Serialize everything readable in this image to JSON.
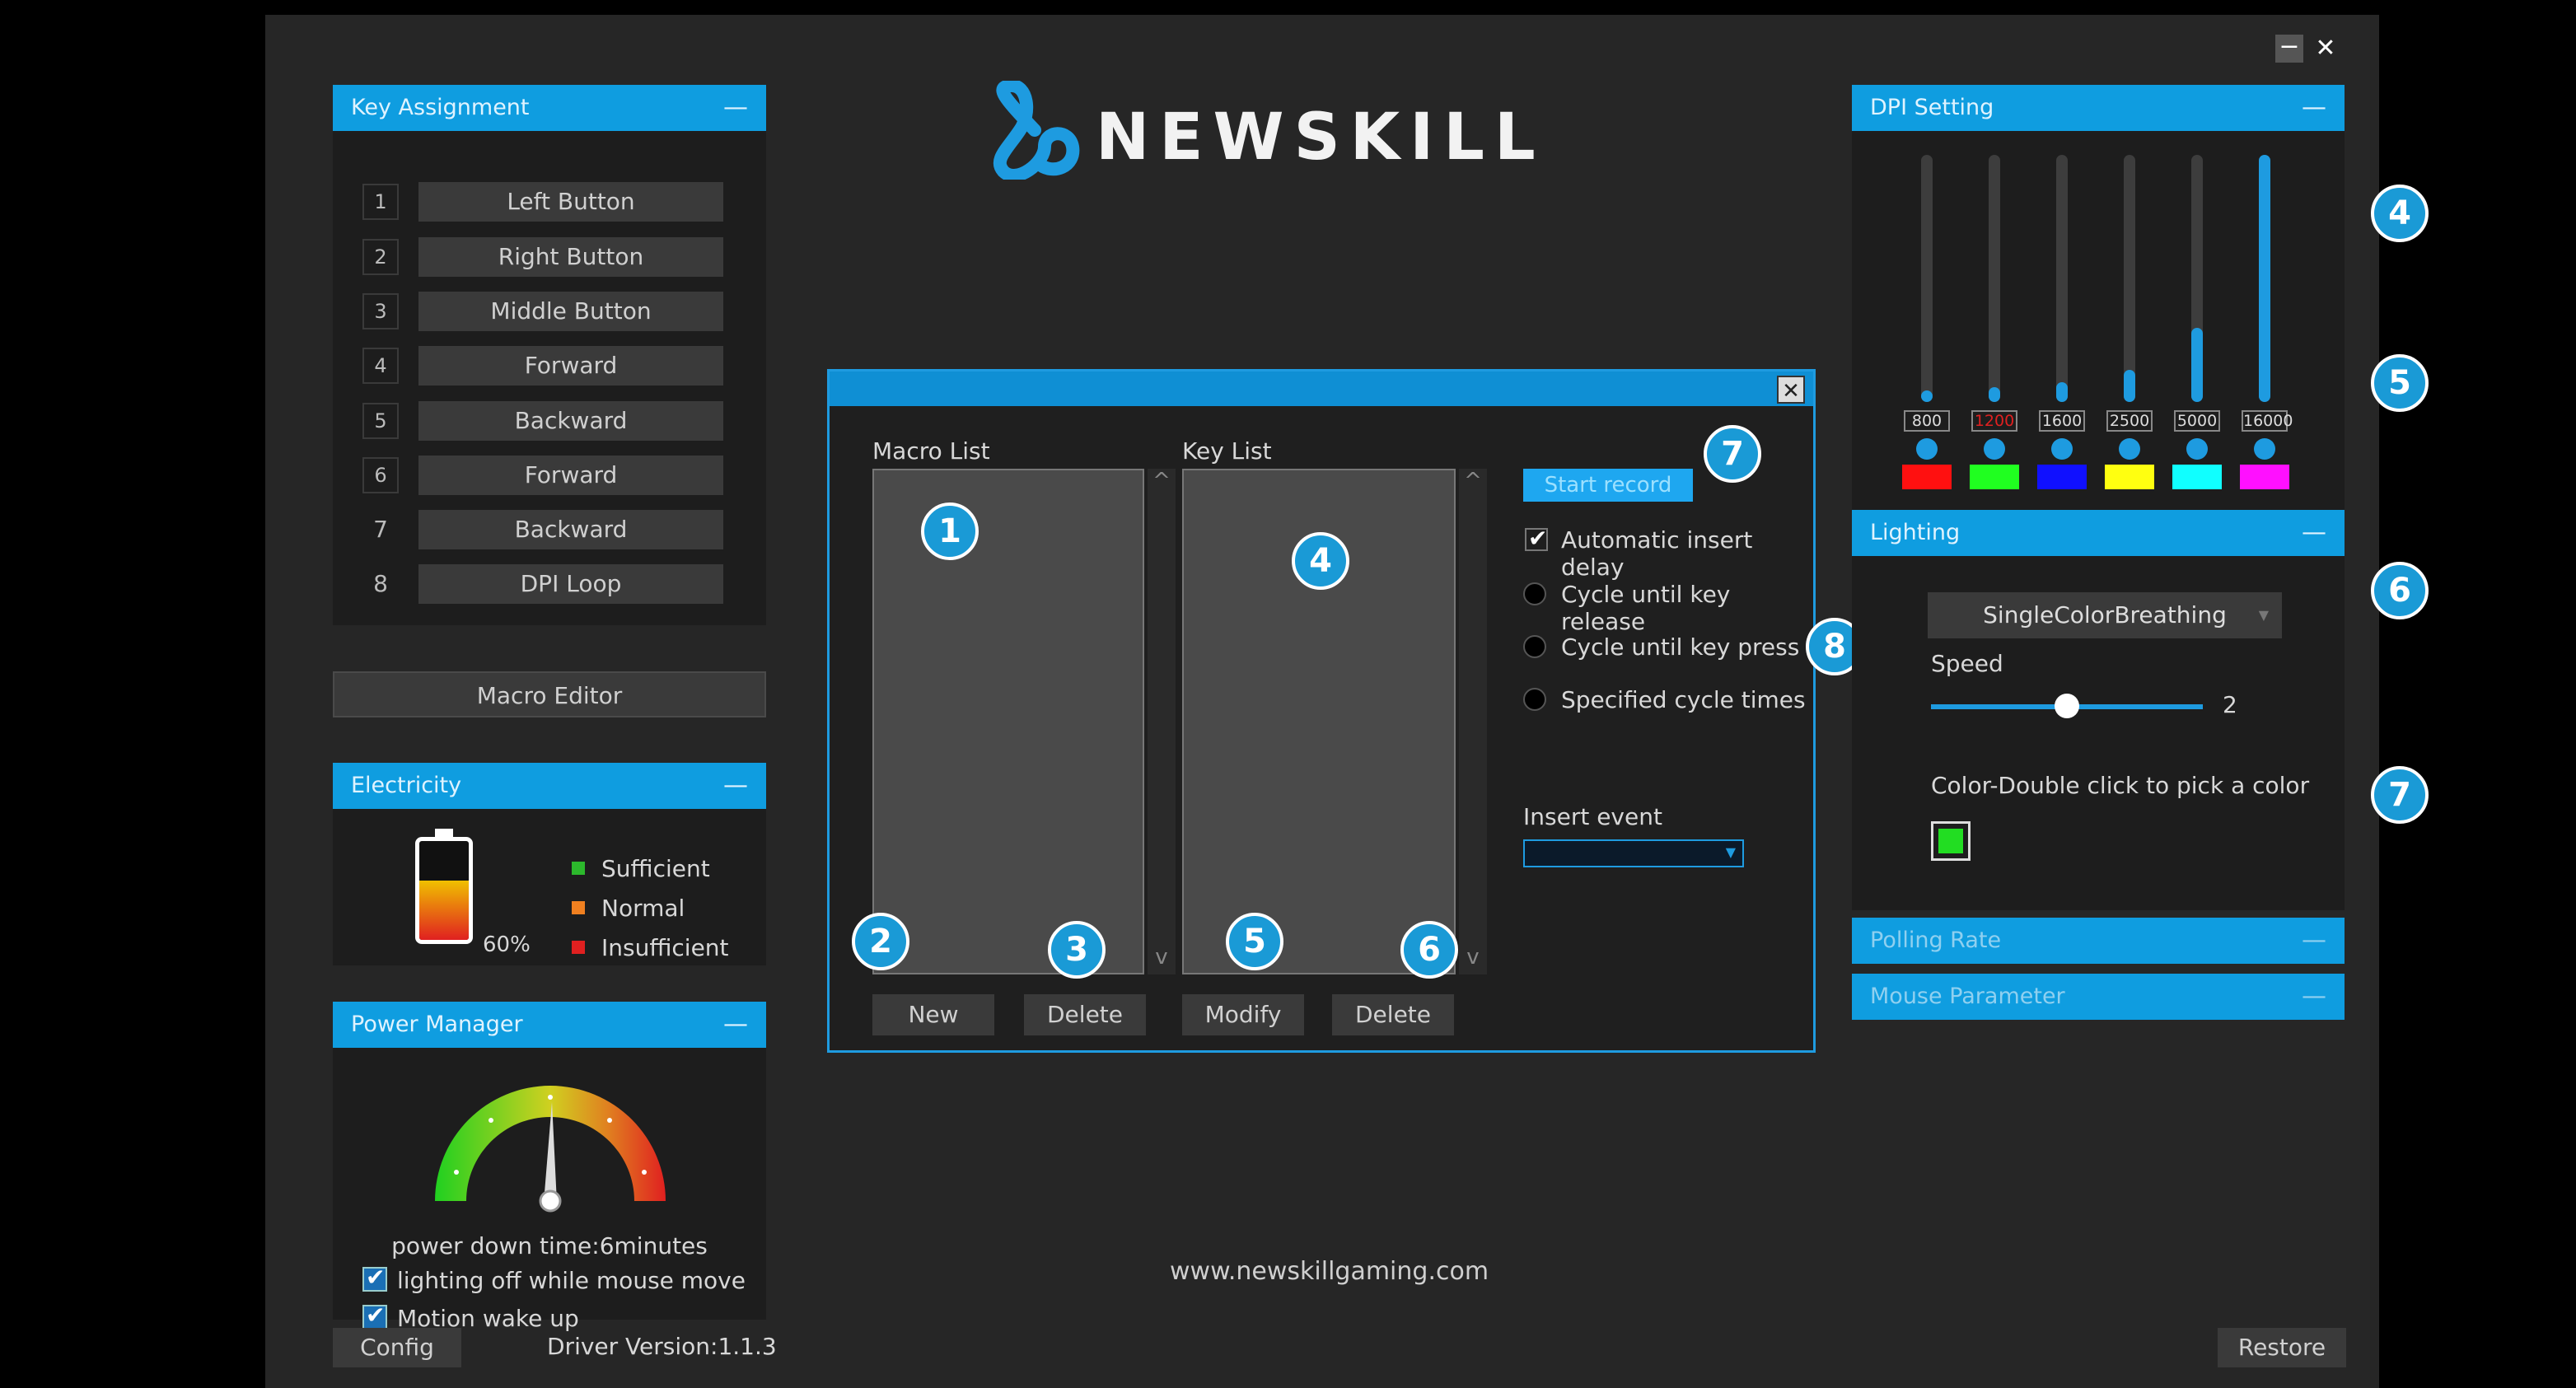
{
  "window": {
    "minimize": "−",
    "close": "✕"
  },
  "key_assignment": {
    "title": "Key Assignment",
    "collapse": "—",
    "rows": [
      {
        "num": "1",
        "label": "Left Button"
      },
      {
        "num": "2",
        "label": "Right Button"
      },
      {
        "num": "3",
        "label": "Middle Button"
      },
      {
        "num": "4",
        "label": "Forward"
      },
      {
        "num": "5",
        "label": "Backward"
      },
      {
        "num": "6",
        "label": "Forward"
      },
      {
        "num": "7",
        "label": "Backward"
      },
      {
        "num": "8",
        "label": "DPI Loop"
      }
    ]
  },
  "macro_editor_button": "Macro Editor",
  "electricity": {
    "title": "Electricity",
    "collapse": "—",
    "percent": "60%",
    "battery_level": 0.6,
    "legend": [
      {
        "label": "Sufficient",
        "color": "#2cb82c"
      },
      {
        "label": "Normal",
        "color": "#f08020"
      },
      {
        "label": "Insufficient",
        "color": "#e02020"
      }
    ]
  },
  "power_manager": {
    "title": "Power Manager",
    "collapse": "—",
    "power_down": "power down time:6minutes",
    "opt1": "lighting off while mouse move",
    "opt2": "Motion wake up"
  },
  "footer": {
    "config": "Config",
    "driver": "Driver Version:1.1.3",
    "restore": "Restore",
    "url": "www.newskillgaming.com"
  },
  "logo": {
    "text": "NEWSKILL"
  },
  "dialog": {
    "close": "✕",
    "macro_list_label": "Macro List",
    "key_list_label": "Key List",
    "start_record": "Start record",
    "auto_delay": "Automatic insert delay",
    "options": [
      "Cycle until key release",
      "Cycle until key press",
      "Specified cycle times"
    ],
    "insert_event": "Insert event",
    "buttons": {
      "new": "New",
      "delete1": "Delete",
      "modify": "Modify",
      "delete2": "Delete"
    },
    "scroll_up": "^",
    "scroll_down": "v"
  },
  "dpi": {
    "title": "DPI Setting",
    "collapse": "—",
    "levels": [
      {
        "value": "800",
        "fill": 0.04,
        "color": "#ff1010",
        "text_color": "#dddddd"
      },
      {
        "value": "1200",
        "fill": 0.06,
        "color": "#20ff20",
        "text_color": "#e02020"
      },
      {
        "value": "1600",
        "fill": 0.08,
        "color": "#1010ff",
        "text_color": "#dddddd"
      },
      {
        "value": "2500",
        "fill": 0.13,
        "color": "#ffff10",
        "text_color": "#dddddd"
      },
      {
        "value": "5000",
        "fill": 0.3,
        "color": "#10ffff",
        "text_color": "#dddddd"
      },
      {
        "value": "16000",
        "fill": 1.0,
        "color": "#ff10ff",
        "text_color": "#dddddd"
      }
    ]
  },
  "lighting": {
    "title": "Lighting",
    "collapse": "—",
    "mode": "SingleColorBreathing",
    "speed_label": "Speed",
    "speed_value": "2",
    "speed_fraction": 0.5,
    "color_label": "Color-Double click to pick a color",
    "color": "#22dd22"
  },
  "polling_rate": {
    "title": "Polling Rate",
    "collapse": "—"
  },
  "mouse_parameter": {
    "title": "Mouse Parameter",
    "collapse": "—"
  },
  "badges": {
    "dialog": [
      "1",
      "2",
      "3",
      "4",
      "5",
      "6",
      "7",
      "8"
    ],
    "right": [
      "4",
      "5",
      "6",
      "7"
    ]
  }
}
